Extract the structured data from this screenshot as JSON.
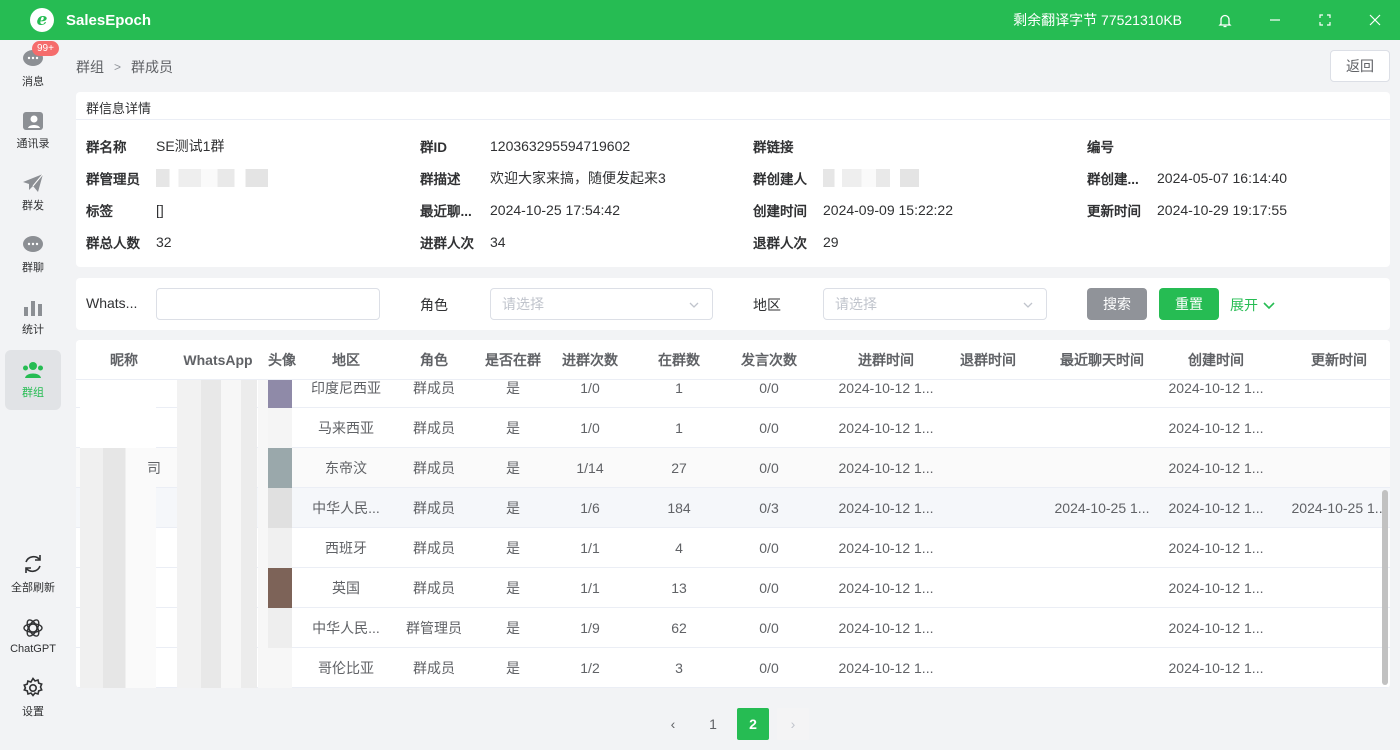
{
  "app": {
    "name": "SalesEpoch",
    "logo_letter": "e",
    "quota": "剩余翻译字节 77521310KB"
  },
  "sidebar": {
    "badge": "99+",
    "items": [
      {
        "label": "消息",
        "icon": "message-icon"
      },
      {
        "label": "通讯录",
        "icon": "contacts-icon"
      },
      {
        "label": "群发",
        "icon": "send-icon"
      },
      {
        "label": "群聊",
        "icon": "group-chat-icon"
      },
      {
        "label": "统计",
        "icon": "stats-icon"
      },
      {
        "label": "群组",
        "icon": "group-icon",
        "active": true
      }
    ],
    "bottom": [
      {
        "label": "全部刷新",
        "icon": "refresh-icon"
      },
      {
        "label": "ChatGPT",
        "icon": "chatgpt-icon"
      },
      {
        "label": "设置",
        "icon": "settings-icon"
      }
    ]
  },
  "breadcrumb": {
    "parent": "群组",
    "current": "群成员"
  },
  "back_label": "返回",
  "info": {
    "title": "群信息详情",
    "fields": {
      "name": {
        "label": "群名称",
        "value": "SE测试1群"
      },
      "gid": {
        "label": "群ID",
        "value": "120363295594719602"
      },
      "link": {
        "label": "群链接",
        "value": ""
      },
      "no": {
        "label": "编号",
        "value": ""
      },
      "admin": {
        "label": "群管理员",
        "value": ""
      },
      "desc": {
        "label": "群描述",
        "value": "欢迎大家来搞，随便发起来3"
      },
      "creator": {
        "label": "群创建人",
        "value": ""
      },
      "created_at": {
        "label": "群创建...",
        "value": "2024-05-07 16:14:40"
      },
      "tags": {
        "label": "标签",
        "value": "[]"
      },
      "last_chat": {
        "label": "最近聊...",
        "value": "2024-10-25 17:54:42"
      },
      "create_time": {
        "label": "创建时间",
        "value": "2024-09-09 15:22:22"
      },
      "update_time": {
        "label": "更新时间",
        "value": "2024-10-29 19:17:55"
      },
      "total": {
        "label": "群总人数",
        "value": "32"
      },
      "joins": {
        "label": "进群人次",
        "value": "34"
      },
      "leaves": {
        "label": "退群人次",
        "value": "29"
      }
    }
  },
  "filter": {
    "whatsapp_label": "Whats...",
    "whatsapp_value": "",
    "role_label": "角色",
    "role_placeholder": "请选择",
    "region_label": "地区",
    "region_placeholder": "请选择",
    "search": "搜索",
    "reset": "重置",
    "expand": "展开"
  },
  "table": {
    "headers": [
      "昵称",
      "WhatsApp",
      "头像",
      "地区",
      "角色",
      "是否在群",
      "进群次数",
      "在群数",
      "发言次数",
      "进群时间",
      "退群时间",
      "最近聊天时间",
      "创建时间",
      "更新时间"
    ],
    "rows": [
      {
        "region": "印度尼西亚",
        "role": "群成员",
        "in_group": "是",
        "joins": "1/0",
        "count": "1",
        "speaks": "0/0",
        "join_time": "2024-10-12 1...",
        "leave_time": "",
        "last_chat": "",
        "created": "2024-10-12 1...",
        "updated": "",
        "nick_suffix": ""
      },
      {
        "region": "马来西亚",
        "role": "群成员",
        "in_group": "是",
        "joins": "1/0",
        "count": "1",
        "speaks": "0/0",
        "join_time": "2024-10-12 1...",
        "leave_time": "",
        "last_chat": "",
        "created": "2024-10-12 1...",
        "updated": "",
        "nick_suffix": ""
      },
      {
        "region": "东帝汶",
        "role": "群成员",
        "in_group": "是",
        "joins": "1/14",
        "count": "27",
        "speaks": "0/0",
        "join_time": "2024-10-12 1...",
        "leave_time": "",
        "last_chat": "",
        "created": "2024-10-12 1...",
        "updated": "",
        "nick_suffix": "司"
      },
      {
        "region": "中华人民...",
        "role": "群成员",
        "in_group": "是",
        "joins": "1/6",
        "count": "184",
        "speaks": "0/3",
        "join_time": "2024-10-12 1...",
        "leave_time": "",
        "last_chat": "2024-10-25 1...",
        "created": "2024-10-12 1...",
        "updated": "2024-10-25 1...",
        "nick_suffix": ""
      },
      {
        "region": "西班牙",
        "role": "群成员",
        "in_group": "是",
        "joins": "1/1",
        "count": "4",
        "speaks": "0/0",
        "join_time": "2024-10-12 1...",
        "leave_time": "",
        "last_chat": "",
        "created": "2024-10-12 1...",
        "updated": "",
        "nick_suffix": ""
      },
      {
        "region": "英国",
        "role": "群成员",
        "in_group": "是",
        "joins": "1/1",
        "count": "13",
        "speaks": "0/0",
        "join_time": "2024-10-12 1...",
        "leave_time": "",
        "last_chat": "",
        "created": "2024-10-12 1...",
        "updated": "",
        "nick_suffix": ""
      },
      {
        "region": "中华人民...",
        "role": "群管理员",
        "in_group": "是",
        "joins": "1/9",
        "count": "62",
        "speaks": "0/0",
        "join_time": "2024-10-12 1...",
        "leave_time": "",
        "last_chat": "",
        "created": "2024-10-12 1...",
        "updated": "",
        "nick_suffix": ""
      },
      {
        "region": "哥伦比亚",
        "role": "群成员",
        "in_group": "是",
        "joins": "1/2",
        "count": "3",
        "speaks": "0/0",
        "join_time": "2024-10-12 1...",
        "leave_time": "",
        "last_chat": "",
        "created": "2024-10-12 1...",
        "updated": "",
        "nick_suffix": ""
      }
    ]
  },
  "pagination": {
    "prev": "‹",
    "pages": [
      "1",
      "2"
    ],
    "current": "2",
    "next": "›"
  },
  "colors": {
    "brand": "#26bc53",
    "badge": "#f56c6c",
    "search_btn": "#909399"
  }
}
